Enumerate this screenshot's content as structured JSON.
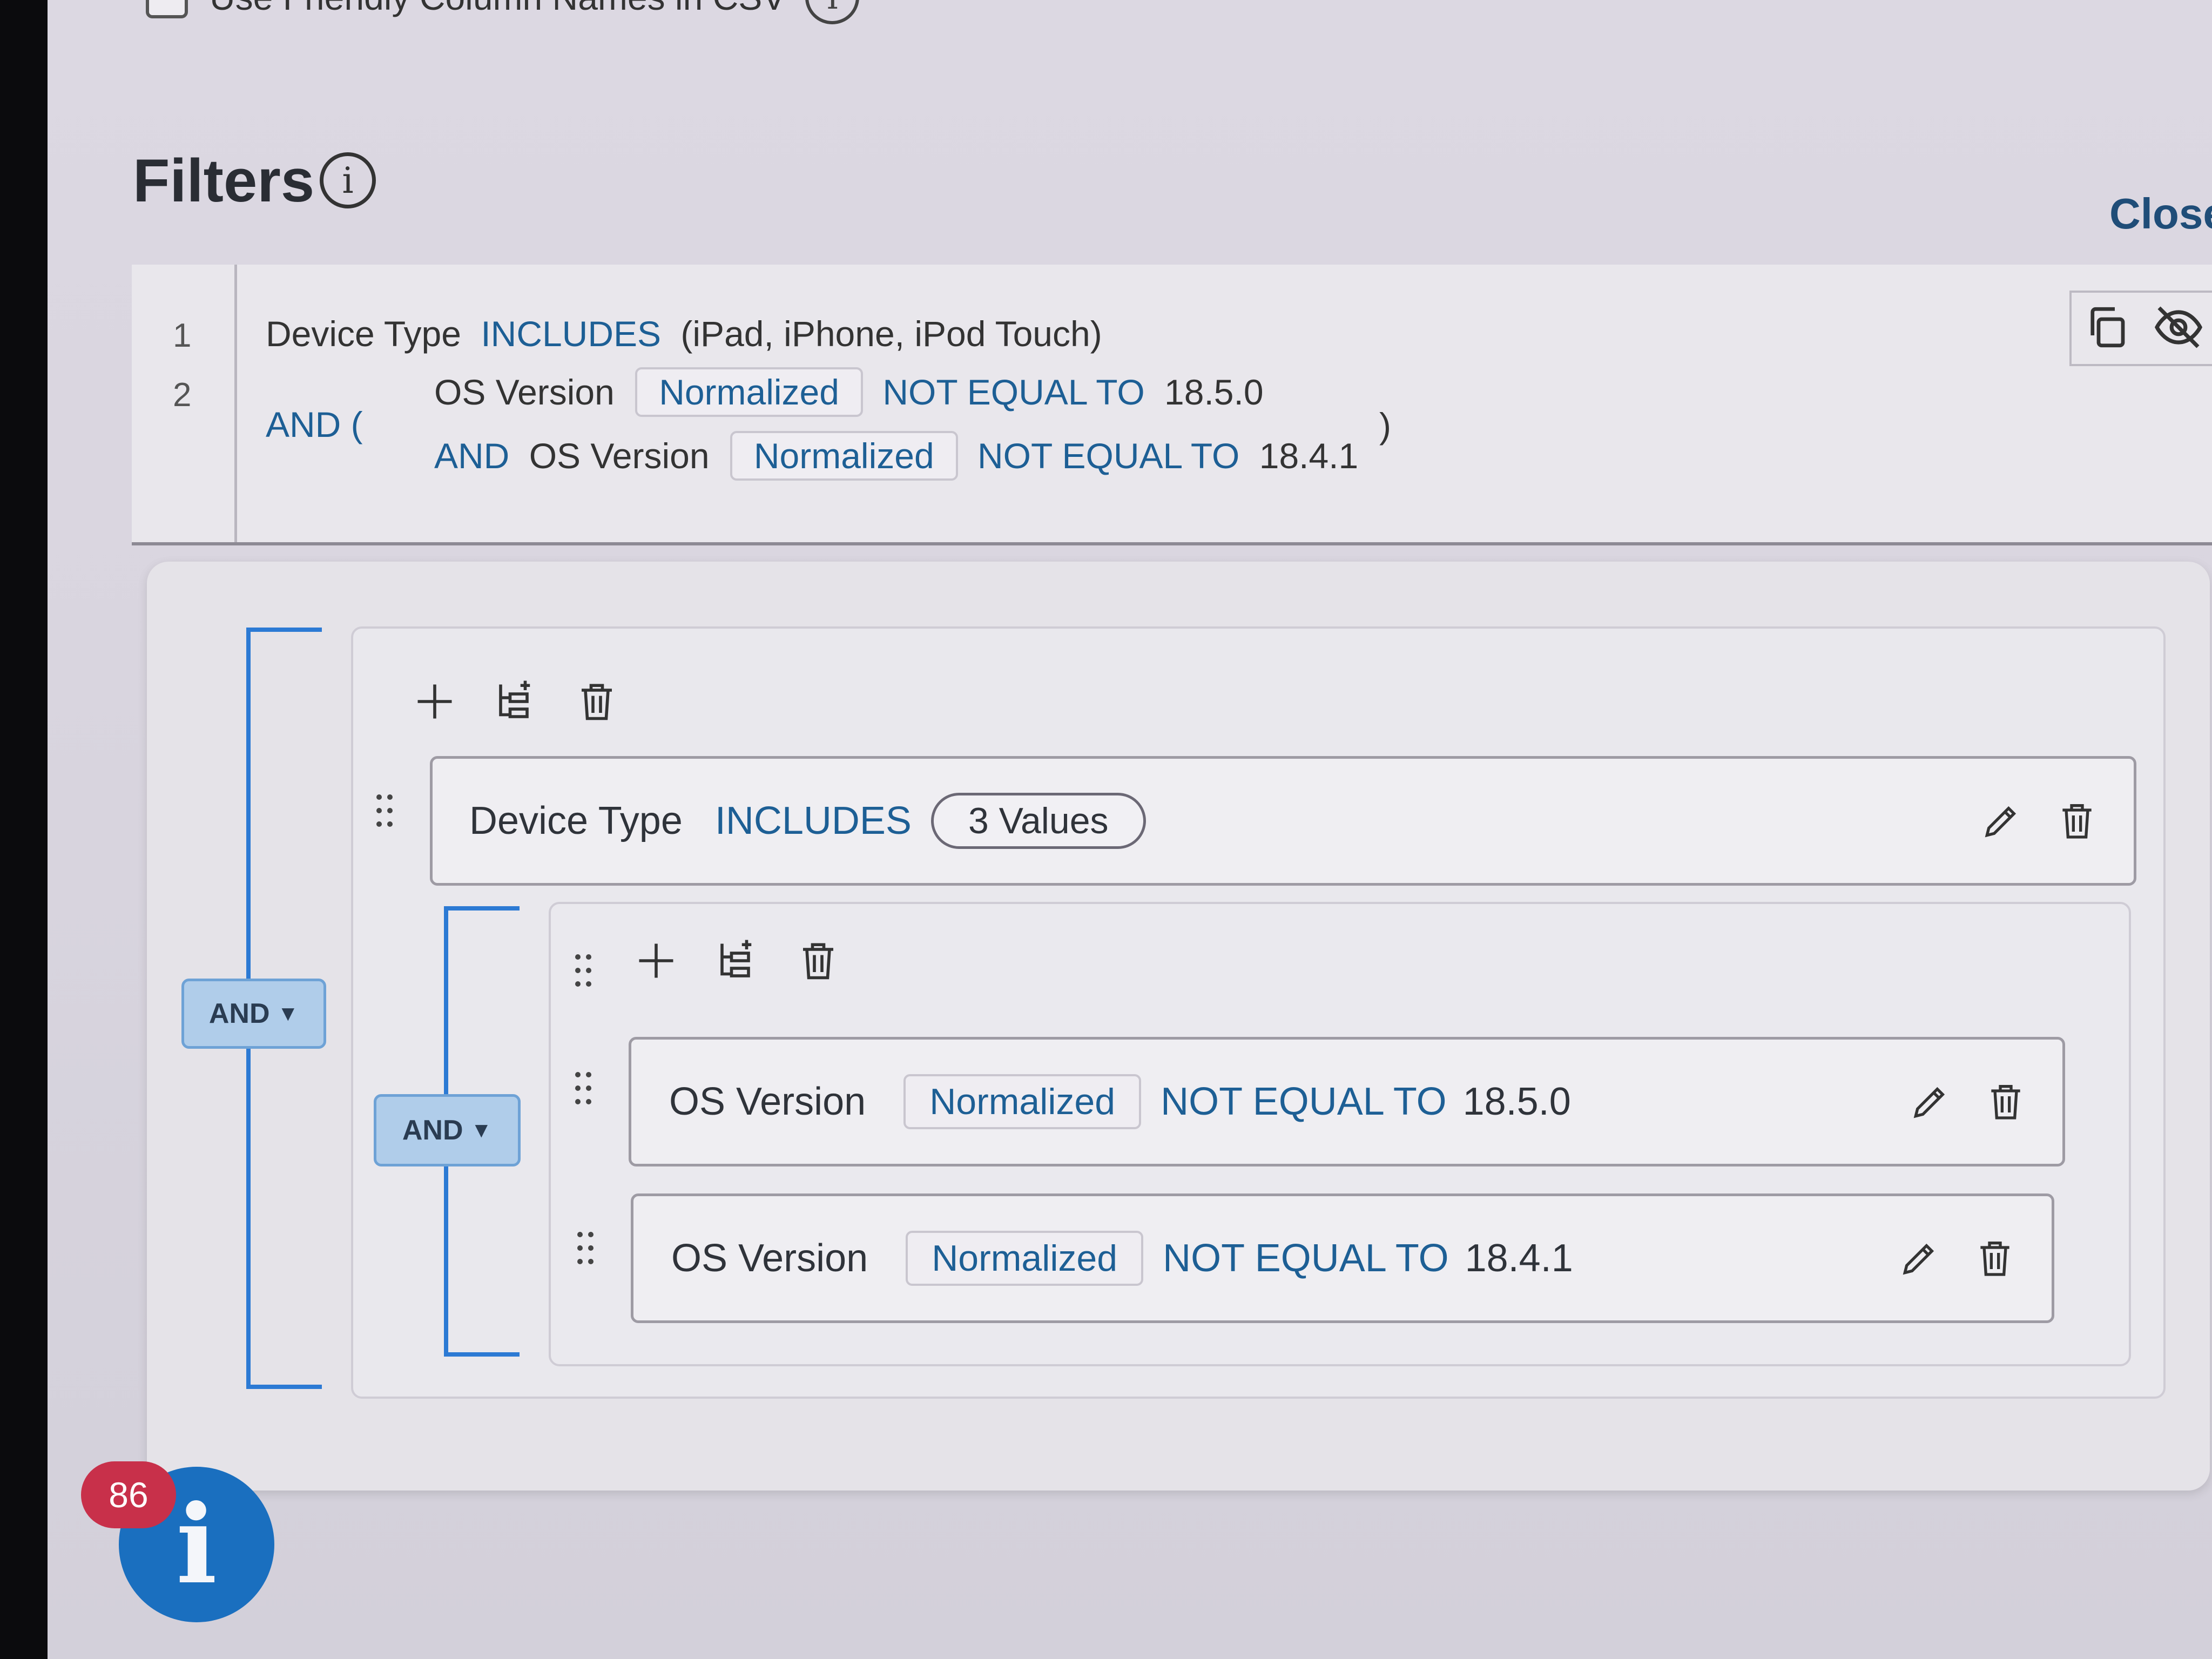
{
  "top_option": {
    "label": "Use Friendly Column Names in CSV",
    "info": "i"
  },
  "filters": {
    "title": "Filters",
    "info": "i",
    "close": "Close"
  },
  "summary": {
    "line1": {
      "num": "1",
      "field": "Device Type",
      "op": "INCLUDES",
      "values": "(iPad, iPhone, iPod Touch)"
    },
    "line2": {
      "num": "2",
      "prefix": "AND (",
      "close_paren": ")",
      "row1": {
        "field": "OS Version",
        "chip": "Normalized",
        "op": "NOT EQUAL TO",
        "value": "18.5.0"
      },
      "row2": {
        "conj": "AND",
        "field": "OS Version",
        "chip": "Normalized",
        "op": "NOT EQUAL TO",
        "value": "18.4.1"
      }
    }
  },
  "builder": {
    "outer_operator": "AND",
    "rule1": {
      "field": "Device Type",
      "op": "INCLUDES",
      "values_pill": "3 Values"
    },
    "inner_operator": "AND",
    "inner_rules": [
      {
        "field": "OS Version",
        "chip": "Normalized",
        "op": "NOT EQUAL TO",
        "value": "18.5.0"
      },
      {
        "field": "OS Version",
        "chip": "Normalized",
        "op": "NOT EQUAL TO",
        "value": "18.4.1"
      }
    ]
  },
  "notification": {
    "count": "86",
    "icon": "info-icon",
    "glyph": "i"
  },
  "colors": {
    "accent": "#1d5f95",
    "bracket": "#2c7ad4",
    "and_button": "#b0cdea",
    "badge": "#c8304a",
    "fab": "#1a6fbf"
  }
}
